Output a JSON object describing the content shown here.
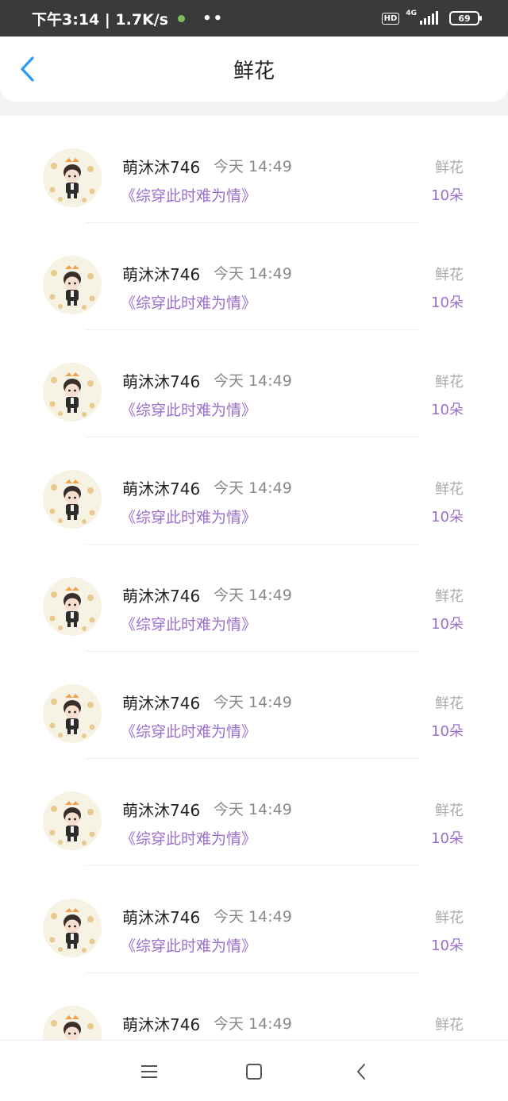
{
  "status_bar": {
    "time_speed": "下午3:14 | 1.7K/s",
    "more": "••",
    "hd": "HD",
    "network": "4G",
    "battery": "69"
  },
  "header": {
    "title": "鲜花"
  },
  "accent_color": "#9b6fc9",
  "back_color": "#2b9af3",
  "rows": [
    {
      "username": "萌沐沐746",
      "time": "今天 14:49",
      "book": "《综穿此时难为情》",
      "gift_type": "鲜花",
      "gift_count": "10朵"
    },
    {
      "username": "萌沐沐746",
      "time": "今天 14:49",
      "book": "《综穿此时难为情》",
      "gift_type": "鲜花",
      "gift_count": "10朵"
    },
    {
      "username": "萌沐沐746",
      "time": "今天 14:49",
      "book": "《综穿此时难为情》",
      "gift_type": "鲜花",
      "gift_count": "10朵"
    },
    {
      "username": "萌沐沐746",
      "time": "今天 14:49",
      "book": "《综穿此时难为情》",
      "gift_type": "鲜花",
      "gift_count": "10朵"
    },
    {
      "username": "萌沐沐746",
      "time": "今天 14:49",
      "book": "《综穿此时难为情》",
      "gift_type": "鲜花",
      "gift_count": "10朵"
    },
    {
      "username": "萌沐沐746",
      "time": "今天 14:49",
      "book": "《综穿此时难为情》",
      "gift_type": "鲜花",
      "gift_count": "10朵"
    },
    {
      "username": "萌沐沐746",
      "time": "今天 14:49",
      "book": "《综穿此时难为情》",
      "gift_type": "鲜花",
      "gift_count": "10朵"
    },
    {
      "username": "萌沐沐746",
      "time": "今天 14:49",
      "book": "《综穿此时难为情》",
      "gift_type": "鲜花",
      "gift_count": "10朵"
    },
    {
      "username": "萌沐沐746",
      "time": "今天 14:49",
      "book": "",
      "gift_type": "鲜花",
      "gift_count": ""
    }
  ],
  "nav": {
    "menu_icon": "menu-icon",
    "home_icon": "home-icon",
    "back_icon": "back-icon"
  }
}
